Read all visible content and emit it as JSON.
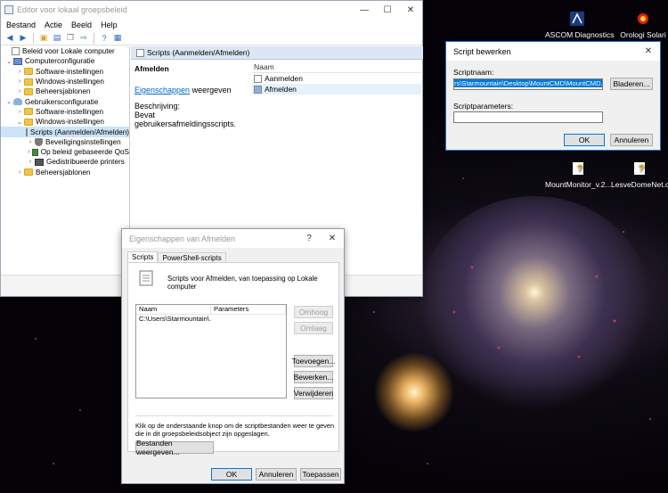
{
  "gpo": {
    "title": "Editor voor lokaal groepsbeleid",
    "menu": [
      "Bestand",
      "Actie",
      "Beeld",
      "Help"
    ],
    "tree": [
      {
        "label": "Beleid voor Lokale computer",
        "level": 0,
        "icon": "doc-icon",
        "chevron": ""
      },
      {
        "label": "Computerconfiguratie",
        "level": 1,
        "icon": "computer-icon",
        "chevron": "⌄"
      },
      {
        "label": "Software-instellingen",
        "level": 2,
        "icon": "folder-icon",
        "chevron": "›"
      },
      {
        "label": "Windows-instellingen",
        "level": 2,
        "icon": "folder-icon",
        "chevron": "›"
      },
      {
        "label": "Beheersjablonen",
        "level": 2,
        "icon": "folder-icon",
        "chevron": "›"
      },
      {
        "label": "Gebruikersconfiguratie",
        "level": 1,
        "icon": "user-icon",
        "chevron": "⌄"
      },
      {
        "label": "Software-instellingen",
        "level": 2,
        "icon": "folder-icon",
        "chevron": "›"
      },
      {
        "label": "Windows-instellingen",
        "level": 2,
        "icon": "folder-icon",
        "chevron": "⌄"
      },
      {
        "label": "Scripts (Aanmelden/Afmelden)",
        "level": 3,
        "icon": "doc-icon",
        "chevron": "",
        "selected": true
      },
      {
        "label": "Beveiligingsinstellingen",
        "level": 3,
        "icon": "shield-icon",
        "chevron": "›"
      },
      {
        "label": "Op beleid gebaseerde QoS",
        "level": 3,
        "icon": "chart-icon",
        "chevron": "›"
      },
      {
        "label": "Gedistribueerde printers",
        "level": 3,
        "icon": "printer-icon",
        "chevron": "›"
      },
      {
        "label": "Beheersjablonen",
        "level": 2,
        "icon": "folder-icon",
        "chevron": "›"
      }
    ],
    "right_header": "Scripts (Aanmelden/Afmelden)",
    "detail_title": "Afmelden",
    "detail_link": "Eigenschappen",
    "detail_link_suffix": " weergeven",
    "description_label": "Beschrijving:",
    "description_text": "Bevat gebruikersafmeldingsscripts.",
    "list_header": "Naam",
    "list_items": [
      "Aanmelden",
      "Afmelden"
    ]
  },
  "edit": {
    "title": "Script bewerken",
    "scriptname_label": "Scriptnaam:",
    "scriptname_value": "rs\\Starmountain\\Desktop\\MountCMD\\MountCMD.bat",
    "browse_label": "Bladeren...",
    "params_label": "Scriptparameters:",
    "params_value": "",
    "ok_label": "OK",
    "cancel_label": "Annuleren"
  },
  "props": {
    "title": "Eigenschappen van Afmelden",
    "help": "?",
    "tabs": [
      "Scripts",
      "PowerShell-scripts"
    ],
    "heading": "Scripts voor Afmelden, van toepassing op Lokale computer",
    "col_name": "Naam",
    "col_params": "Parameters",
    "row_name": "C:\\Users\\Starmountain\\...",
    "row_params": "",
    "btn_up": "Omhoog",
    "btn_down": "Omlaag",
    "btn_add": "Toevoegen...",
    "btn_edit": "Bewerken...",
    "btn_remove": "Verwijderen",
    "note": "Klik op de onderstaande knop om de scriptbestanden weer te geven die in dit groepsbeleidsobject zijn opgeslagen.",
    "btn_show": "Bestanden weergeven...",
    "btn_ok": "OK",
    "btn_cancel": "Annuleren",
    "btn_apply": "Toepassen"
  },
  "desktop": [
    {
      "label": "ASCOM Diagnostics"
    },
    {
      "label": "Orologi Solari"
    },
    {
      "label": "MountMonitor_v.2..."
    },
    {
      "label": "LesveDomeNet.che"
    }
  ]
}
